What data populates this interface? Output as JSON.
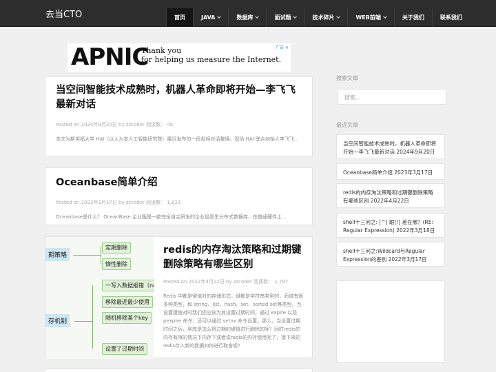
{
  "site": {
    "brand": "去当CTO"
  },
  "nav": [
    {
      "label": "首页",
      "dropdown": false,
      "active": true
    },
    {
      "label": "JAVA",
      "dropdown": true,
      "active": false
    },
    {
      "label": "数据库",
      "dropdown": true,
      "active": false
    },
    {
      "label": "面试题",
      "dropdown": true,
      "active": false
    },
    {
      "label": "技术碎片",
      "dropdown": true,
      "active": false
    },
    {
      "label": "WEB前端",
      "dropdown": true,
      "active": false
    },
    {
      "label": "关于我们",
      "dropdown": false,
      "active": false
    },
    {
      "label": "联系我们",
      "dropdown": false,
      "active": false
    }
  ],
  "ad": {
    "logo": "APNIC",
    "line1": "Thank you",
    "line2": "for helping us measure the Internet.",
    "close": "广告 ✕"
  },
  "posts": [
    {
      "title": "当空间智能技术成熟时，机器人革命即将开始—李飞飞最新对话",
      "meta": "Posted on 2024年9月20日 by zzcoder 阅读数： 45",
      "excerpt": "本文为斯坦福大学 HAI（以人为本人工智能研究院）最近发布的一段视频对话整理。现场 HAI 联合创始人李飞飞..."
    },
    {
      "title": "Oceanbase简单介绍",
      "meta": "Posted on 2023年3月17日 by zzcoder 阅读数： 1,829",
      "excerpt": "Oceanbase是什么？ OceanBase 企业版是一款完全自主研发的企业级原生分布式数据库，在普通硬件上..."
    },
    {
      "title": "redis的内存淘汰策略和过期键删除策略有哪些区别",
      "meta": "Posted on 2022年4月22日 by zzcoder 阅读数： 1,797",
      "excerpt": "Redis 中都是键值对的存储形式，键都是字符串类型的，而值有很多种类型，如 string、list、hash、set、sorted set等类型。当设置键值对时我们还应该为其设置过期时间，通过 expire 以及 pexpire 命令；还可以通过 setnx 命令设置。那么，当设置过期时间之后，到底是怎么将过期的键值进行删除的呢？同时redis的内存有限的情况下内存下或者说redis的内存使用完了，接下来的redis存入新的数据如何进行取舍呢?",
      "thumb": {
        "root1": "期策略",
        "root2": "存机制",
        "nodes": [
          "定期删除",
          "惰性删除",
          "一写入数据报错（no",
          "移除最近最少使用",
          "随机移除某个key",
          "设置了过期时间"
        ]
      }
    }
  ],
  "sidebar": {
    "search_heading": "搜索文章",
    "search_placeholder": "搜索...",
    "recent_heading": "最近文章",
    "recent": [
      {
        "title": "当空间智能技术成熟时，机器人革命即将开始—李飞飞最新对话",
        "date": "2024年9月20日"
      },
      {
        "title": "Oceanbase简单介绍",
        "date": "2023年3月17日"
      },
      {
        "title": "redis的内存淘汰策略和过期键删除策略有哪些区别",
        "date": "2022年4月22日"
      },
      {
        "title": "shell十三问之: [^] 跟[!] 差在哪？(RE: Regular Expression)",
        "date": "2022年3月18日"
      },
      {
        "title": "shell十三问之:Wildcard与Regular Expression的差别",
        "date": "2022年3月17日"
      }
    ]
  }
}
